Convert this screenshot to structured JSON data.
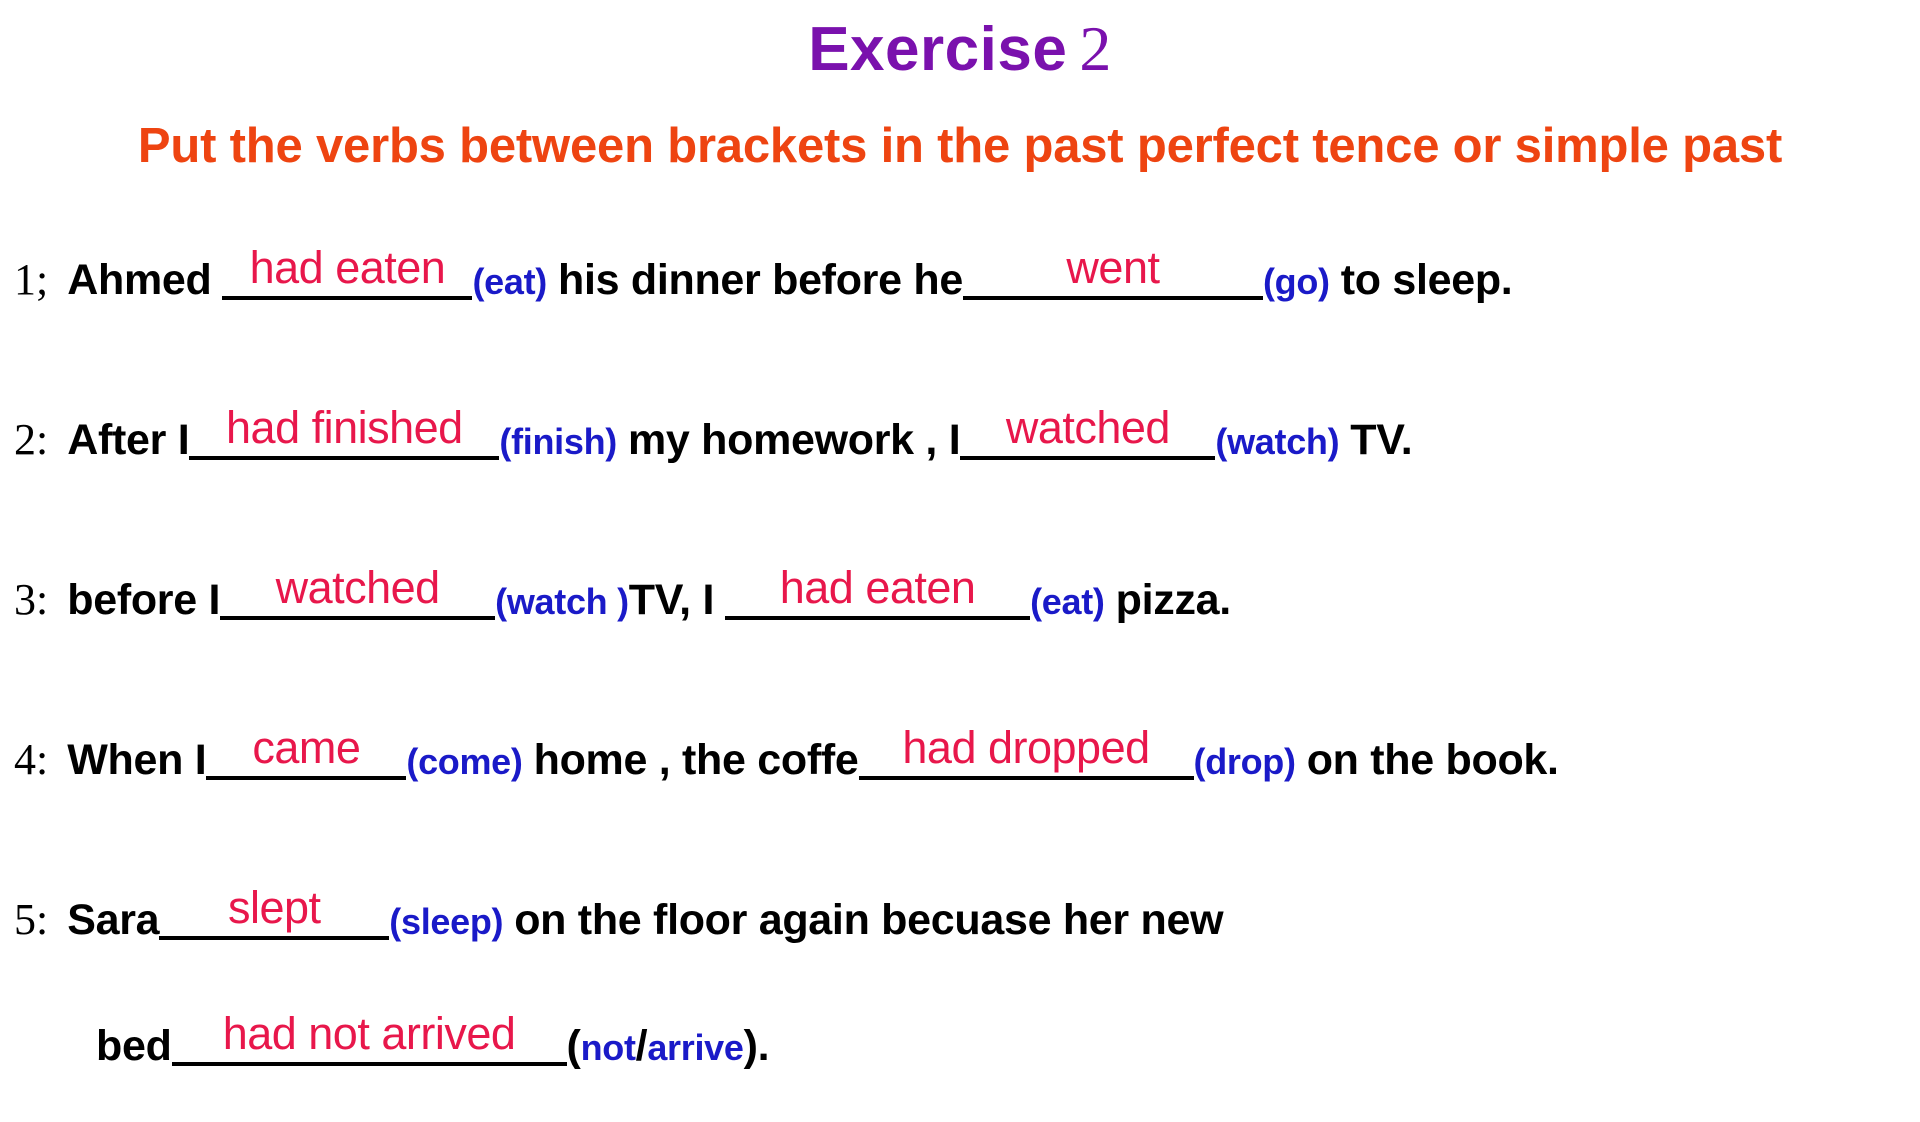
{
  "page": {
    "background_color": "#ffffff",
    "title_color": "#7a11ad",
    "subtitle_color": "#ee4411",
    "answer_color": "#e8174b",
    "cue_color": "#1a1ac8",
    "text_color": "#000000"
  },
  "header": {
    "title_word": "Exercise",
    "title_number": "2",
    "subtitle": "Put the verbs between brackets in the past perfect tence or simple past"
  },
  "questions": [
    {
      "number": "1;",
      "parts": {
        "lead": "Ahmed",
        "answer1": "had eaten",
        "cue1": "(eat)",
        "mid": "his dinner before he",
        "answer2": "went",
        "cue2": "(go)",
        "tail": "to sleep."
      }
    },
    {
      "number": "2:",
      "parts": {
        "lead": "After I",
        "answer1": "had finished",
        "cue1": "(finish)",
        "mid": "my homework , I",
        "answer2": "watched",
        "cue2": "(watch)",
        "tail": "TV."
      }
    },
    {
      "number": "3:",
      "parts": {
        "lead": "before I",
        "answer1": "watched",
        "cue1": "(watch )",
        "mid": "TV, I",
        "answer2": "had eaten",
        "cue2": "(eat)",
        "tail": "pizza."
      }
    },
    {
      "number": "4:",
      "parts": {
        "lead": "When I",
        "answer1": "came",
        "cue1": "(come)",
        "mid": "home , the coffe",
        "answer2": "had dropped",
        "cue2": "(drop)",
        "tail": "on the book."
      }
    },
    {
      "number": "5:",
      "parts": {
        "lead": "Sara",
        "answer1": "slept",
        "cue1": "(sleep)",
        "tail": "on the floor again becuase her new"
      }
    }
  ],
  "continuation": {
    "lead": "bed",
    "answer": "had not arrived",
    "cue_open": "(",
    "cue_not": "not",
    "cue_slash": "/",
    "cue_arrive": "arrive",
    "tail": ")."
  }
}
